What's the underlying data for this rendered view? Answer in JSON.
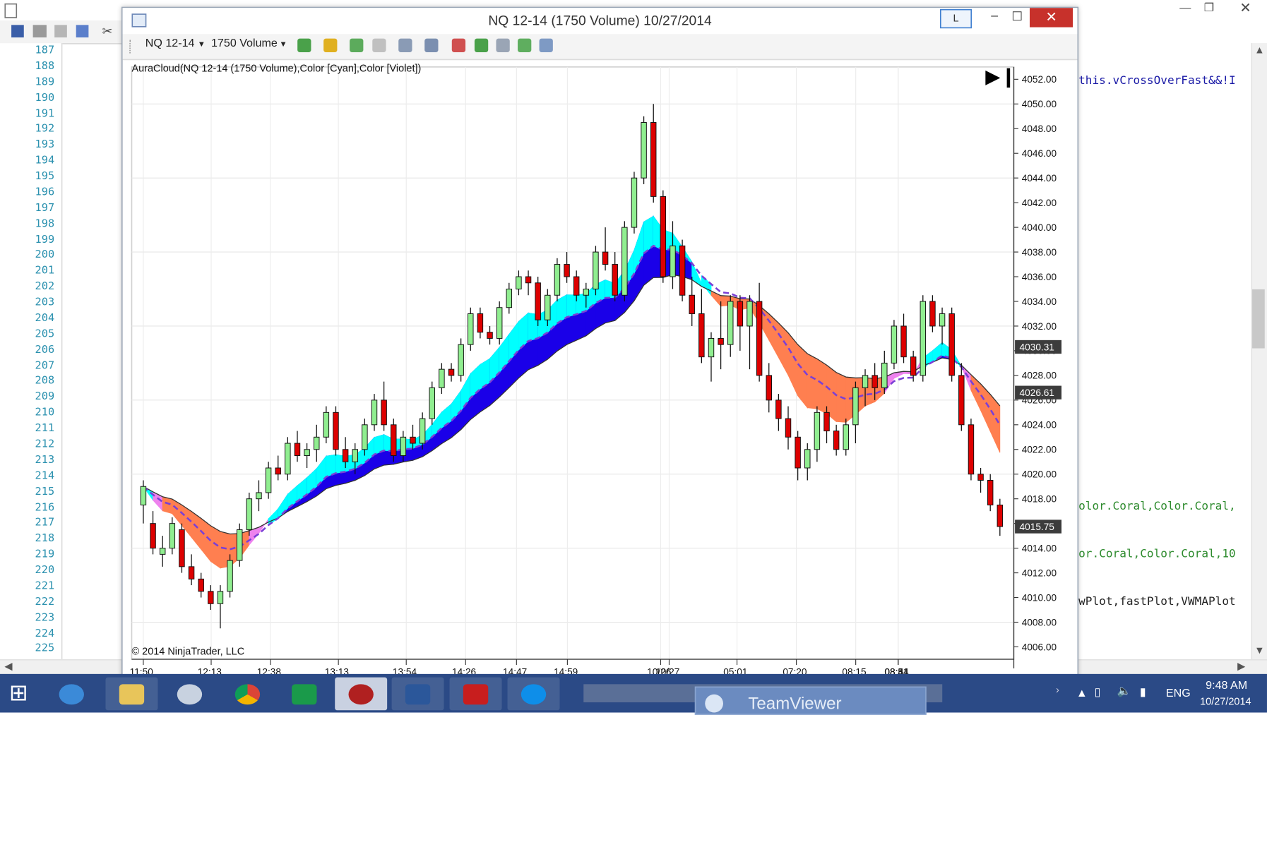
{
  "editor": {
    "line_numbers": [
      "187",
      "188",
      "189",
      "190",
      "191",
      "192",
      "193",
      "194",
      "195",
      "196",
      "197",
      "198",
      "199",
      "200",
      "201",
      "202",
      "203",
      "204",
      "205",
      "206",
      "207",
      "208",
      "209",
      "210",
      "211",
      "212",
      "213",
      "214",
      "215",
      "216",
      "217",
      "218",
      "219",
      "220",
      "221",
      "222",
      "223",
      "224",
      "225"
    ],
    "code_lines": [
      {
        "text": "this.vCrossOverFast&&!I",
        "color": "#1a1aa6"
      },
      {
        "text": "olor.Coral,Color.Coral,",
        "color": "#2e8b2e"
      },
      {
        "text": "or.Coral,Color.Coral,10",
        "color": "#2e8b2e"
      },
      {
        "text": "wPlot,fastPlot,VWMAPlot",
        "color": "#222222"
      }
    ]
  },
  "chart_window": {
    "title": "NQ 12-14 (1750 Volume)  10/27/2014",
    "layout_button": "L",
    "toolbar": {
      "instrument": "NQ 12-14",
      "interval": "1750 Volume"
    },
    "indicator_label": "AuraCloud(NQ 12-14 (1750 Volume),Color [Cyan],Color [Violet])",
    "copyright": "© 2014 NinjaTrader, LLC"
  },
  "chart_data": {
    "type": "candlestick",
    "title": "NQ 12-14 (1750 Volume)",
    "x_tick_labels": [
      "11:50",
      "12:13",
      "12:38",
      "13:13",
      "13:54",
      "14:26",
      "14:47",
      "14:59",
      "10/26",
      "10/27",
      "05:01",
      "07:20",
      "08:15",
      "08:34",
      "08:41",
      "08:51"
    ],
    "y_tick_labels": [
      "4006.00",
      "4008.00",
      "4010.00",
      "4012.00",
      "4014.00",
      "4016.00",
      "4018.00",
      "4020.00",
      "4022.00",
      "4024.00",
      "4026.00",
      "4028.00",
      "4030.00",
      "4032.00",
      "4034.00",
      "4036.00",
      "4038.00",
      "4040.00",
      "4042.00",
      "4044.00",
      "4046.00",
      "4048.00",
      "4050.00",
      "4052.00"
    ],
    "ylim": [
      4005,
      4053
    ],
    "price_markers": [
      "4030.31",
      "4026.61",
      "4015.75"
    ],
    "ohlc": [
      [
        4017.5,
        4019.5,
        4016.0,
        4019.0
      ],
      [
        4016.0,
        4017.0,
        4013.5,
        4014.0
      ],
      [
        4013.5,
        4015.0,
        4012.5,
        4014.0
      ],
      [
        4014.0,
        4016.5,
        4013.5,
        4016.0
      ],
      [
        4015.5,
        4016.0,
        4012.0,
        4012.5
      ],
      [
        4012.5,
        4013.5,
        4011.0,
        4011.5
      ],
      [
        4011.5,
        4012.0,
        4010.0,
        4010.5
      ],
      [
        4010.5,
        4011.0,
        4009.0,
        4009.5
      ],
      [
        4009.5,
        4011.0,
        4007.5,
        4010.5
      ],
      [
        4010.5,
        4013.5,
        4010.0,
        4013.0
      ],
      [
        4013.0,
        4016.0,
        4012.5,
        4015.5
      ],
      [
        4015.5,
        4018.5,
        4015.0,
        4018.0
      ],
      [
        4018.0,
        4019.5,
        4017.0,
        4018.5
      ],
      [
        4018.5,
        4021.0,
        4018.0,
        4020.5
      ],
      [
        4020.5,
        4021.5,
        4019.5,
        4020.0
      ],
      [
        4020.0,
        4023.0,
        4019.5,
        4022.5
      ],
      [
        4022.5,
        4023.5,
        4021.0,
        4021.5
      ],
      [
        4021.5,
        4022.5,
        4020.5,
        4022.0
      ],
      [
        4022.0,
        4024.0,
        4021.0,
        4023.0
      ],
      [
        4023.0,
        4025.5,
        4022.5,
        4025.0
      ],
      [
        4025.0,
        4025.5,
        4021.5,
        4022.0
      ],
      [
        4022.0,
        4023.0,
        4020.5,
        4021.0
      ],
      [
        4021.0,
        4022.5,
        4020.0,
        4022.0
      ],
      [
        4022.0,
        4024.5,
        4021.5,
        4024.0
      ],
      [
        4024.0,
        4026.5,
        4023.5,
        4026.0
      ],
      [
        4026.0,
        4027.5,
        4023.5,
        4024.0
      ],
      [
        4024.0,
        4024.5,
        4021.0,
        4021.5
      ],
      [
        4021.5,
        4023.5,
        4021.0,
        4023.0
      ],
      [
        4023.0,
        4024.0,
        4022.0,
        4022.5
      ],
      [
        4022.5,
        4025.0,
        4022.0,
        4024.5
      ],
      [
        4024.5,
        4027.5,
        4024.0,
        4027.0
      ],
      [
        4027.0,
        4029.0,
        4026.5,
        4028.5
      ],
      [
        4028.5,
        4029.0,
        4027.5,
        4028.0
      ],
      [
        4028.0,
        4031.0,
        4027.5,
        4030.5
      ],
      [
        4030.5,
        4033.5,
        4030.0,
        4033.0
      ],
      [
        4033.0,
        4033.5,
        4031.0,
        4031.5
      ],
      [
        4031.5,
        4032.0,
        4030.5,
        4031.0
      ],
      [
        4031.0,
        4034.0,
        4030.5,
        4033.5
      ],
      [
        4033.5,
        4035.5,
        4033.0,
        4035.0
      ],
      [
        4035.0,
        4036.5,
        4034.5,
        4036.0
      ],
      [
        4036.0,
        4036.5,
        4034.5,
        4035.5
      ],
      [
        4035.5,
        4036.0,
        4032.0,
        4032.5
      ],
      [
        4032.5,
        4035.0,
        4032.0,
        4034.5
      ],
      [
        4034.5,
        4037.5,
        4034.0,
        4037.0
      ],
      [
        4037.0,
        4038.0,
        4035.5,
        4036.0
      ],
      [
        4036.0,
        4036.5,
        4034.0,
        4034.5
      ],
      [
        4034.5,
        4035.5,
        4033.5,
        4035.0
      ],
      [
        4035.0,
        4038.5,
        4034.5,
        4038.0
      ],
      [
        4038.0,
        4040.0,
        4036.5,
        4037.0
      ],
      [
        4037.0,
        4038.0,
        4034.0,
        4034.5
      ],
      [
        4034.5,
        4040.5,
        4034.0,
        4040.0
      ],
      [
        4040.0,
        4044.5,
        4039.5,
        4044.0
      ],
      [
        4044.0,
        4049.0,
        4043.5,
        4048.5
      ],
      [
        4048.5,
        4050.0,
        4042.0,
        4042.5
      ],
      [
        4042.5,
        4043.0,
        4035.5,
        4036.0
      ],
      [
        4036.0,
        4040.5,
        4035.0,
        4038.5
      ],
      [
        4038.5,
        4039.0,
        4034.0,
        4034.5
      ],
      [
        4034.5,
        4036.0,
        4032.0,
        4033.0
      ],
      [
        4033.0,
        4035.0,
        4029.0,
        4029.5
      ],
      [
        4029.5,
        4031.5,
        4027.5,
        4031.0
      ],
      [
        4031.0,
        4034.0,
        4028.5,
        4030.5
      ],
      [
        4030.5,
        4034.5,
        4029.5,
        4034.0
      ],
      [
        4034.0,
        4034.5,
        4030.0,
        4032.0
      ],
      [
        4032.0,
        4034.5,
        4028.5,
        4034.0
      ],
      [
        4034.0,
        4035.5,
        4027.5,
        4028.0
      ],
      [
        4028.0,
        4029.0,
        4025.0,
        4026.0
      ],
      [
        4026.0,
        4026.5,
        4023.5,
        4024.5
      ],
      [
        4024.5,
        4025.5,
        4022.0,
        4023.0
      ],
      [
        4023.0,
        4023.5,
        4019.5,
        4020.5
      ],
      [
        4020.5,
        4022.5,
        4019.5,
        4022.0
      ],
      [
        4022.0,
        4025.5,
        4021.0,
        4025.0
      ],
      [
        4025.0,
        4025.5,
        4022.5,
        4023.5
      ],
      [
        4023.5,
        4024.0,
        4021.5,
        4022.0
      ],
      [
        4022.0,
        4024.5,
        4021.5,
        4024.0
      ],
      [
        4024.0,
        4027.5,
        4022.5,
        4027.0
      ],
      [
        4027.0,
        4028.5,
        4025.5,
        4028.0
      ],
      [
        4028.0,
        4029.0,
        4026.0,
        4027.0
      ],
      [
        4027.0,
        4030.0,
        4026.5,
        4029.0
      ],
      [
        4029.0,
        4032.5,
        4028.5,
        4032.0
      ],
      [
        4032.0,
        4033.0,
        4029.0,
        4029.5
      ],
      [
        4029.5,
        4030.0,
        4027.5,
        4028.0
      ],
      [
        4028.0,
        4034.5,
        4027.5,
        4034.0
      ],
      [
        4034.0,
        4034.5,
        4031.5,
        4032.0
      ],
      [
        4032.0,
        4033.5,
        4030.5,
        4033.0
      ],
      [
        4033.0,
        4033.5,
        4027.5,
        4028.0
      ],
      [
        4028.0,
        4029.0,
        4023.5,
        4024.0
      ],
      [
        4024.0,
        4024.5,
        4019.5,
        4020.0
      ],
      [
        4020.0,
        4020.5,
        4018.5,
        4019.5
      ],
      [
        4019.5,
        4020.0,
        4017.0,
        4017.5
      ],
      [
        4017.5,
        4018.0,
        4015.0,
        4015.75
      ]
    ],
    "cloud_colors": {
      "bull": "#00ffff",
      "bull_strong": "#1a00e8",
      "bear": "#ee82ee",
      "bear_strong": "#ff7f50"
    },
    "up_color": "#90ee90",
    "down_color": "#dd0000"
  },
  "taskbar": {
    "apps": [
      "start",
      "internet-explorer",
      "file-explorer",
      "hp",
      "chrome",
      "store",
      "ninjatrader",
      "word",
      "acrobat",
      "teamviewer"
    ],
    "popup_title": "TeamViewer",
    "lang": "ENG",
    "time": "9:48 AM",
    "date": "10/27/2014"
  }
}
